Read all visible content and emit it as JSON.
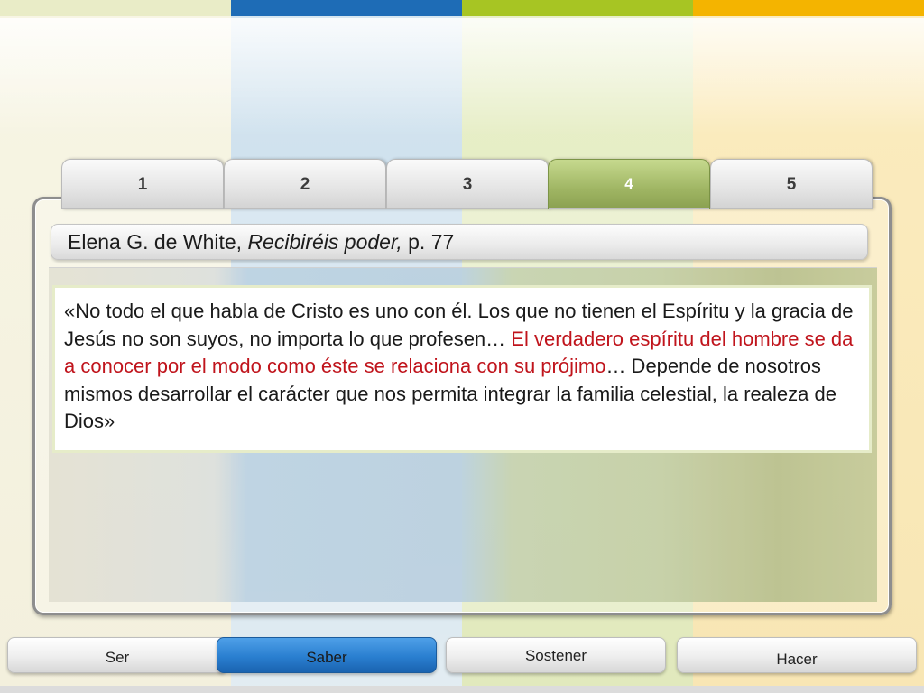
{
  "tabs": [
    {
      "label": "1",
      "active": false
    },
    {
      "label": "2",
      "active": false
    },
    {
      "label": "3",
      "active": false
    },
    {
      "label": "4",
      "active": true
    },
    {
      "label": "5",
      "active": false
    }
  ],
  "header": {
    "author": "Elena G. de White, ",
    "book": "Recibiréis poder,",
    "page": " p. 77"
  },
  "quote": {
    "part1": "«No todo el que habla de Cristo es uno con él.  Los que no tienen el Espíritu y la gracia de Jesús no son suyos, no importa lo que profesen… ",
    "highlight": "El verdadero espíritu del hombre se da a conocer por el modo como éste se relaciona con su prójimo",
    "part2": "… Depende de nosotros mismos desarrollar el carácter que nos permita integrar la familia celestial, la realeza de Dios»"
  },
  "nav": [
    {
      "label": "Ser",
      "active": false
    },
    {
      "label": "Saber",
      "active": true
    },
    {
      "label": "Sostener",
      "active": false
    },
    {
      "label": "Hacer",
      "active": false
    }
  ],
  "colors": {
    "highlight_text": "#c0141c",
    "active_tab": "#9fb563",
    "active_nav": "#2a7fd0"
  }
}
